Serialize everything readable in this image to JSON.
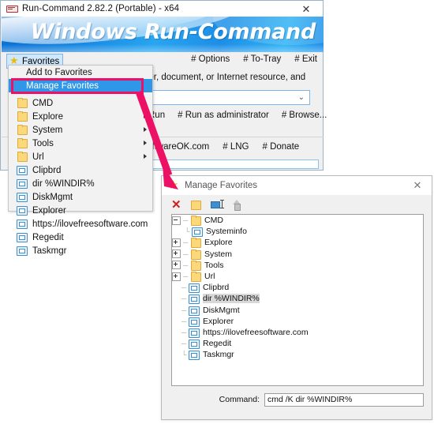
{
  "main_window": {
    "title": "Run-Command 2.82.2 (Portable) - x64",
    "close_label": "✕",
    "banner_text": "Windows Run-Command",
    "favorites_button": "Favorites",
    "top_menu": [
      "# Options",
      "# To-Tray",
      "# Exit"
    ],
    "description": "der, document, or Internet resource, and",
    "combo_value": "",
    "combo_chevron": "⌄",
    "action_buttons": [
      "Run",
      "# Run as administrator",
      "# Browse..."
    ],
    "footer_items": [
      "oftwareOK.com",
      "# LNG",
      "# Donate"
    ]
  },
  "favorites_menu": {
    "top_items": [
      {
        "label": "Add to Favorites",
        "selected": false
      },
      {
        "label": "Manage Favorites",
        "selected": true
      }
    ],
    "folders": [
      {
        "label": "CMD",
        "icon": "folder-icon",
        "has_submenu": true
      },
      {
        "label": "Explore",
        "icon": "folder-icon",
        "has_submenu": true
      },
      {
        "label": "System",
        "icon": "folder-icon",
        "has_submenu": true
      },
      {
        "label": "Tools",
        "icon": "folder-icon",
        "has_submenu": true
      },
      {
        "label": "Url",
        "icon": "folder-icon",
        "has_submenu": true
      }
    ],
    "commands": [
      {
        "label": "Clipbrd",
        "icon": "script-icon"
      },
      {
        "label": "dir %WINDIR%",
        "icon": "script-icon"
      },
      {
        "label": "DiskMgmt",
        "icon": "script-icon"
      },
      {
        "label": "Explorer",
        "icon": "script-icon"
      },
      {
        "label": "https://ilovefreesoftware.com",
        "icon": "script-icon"
      },
      {
        "label": "Regedit",
        "icon": "script-icon"
      },
      {
        "label": "Taskmgr",
        "icon": "script-icon"
      }
    ]
  },
  "manage_favorites": {
    "title": "Manage Favorites",
    "close_label": "✕",
    "toolbar": [
      {
        "name": "delete-icon",
        "glyph": "✕"
      },
      {
        "name": "new-folder-icon",
        "glyph": ""
      },
      {
        "name": "rename-icon",
        "glyph": ""
      },
      {
        "name": "move-up-icon",
        "glyph": ""
      }
    ],
    "tree": [
      {
        "label": "CMD",
        "icon": "folder-icon",
        "expander": "minus",
        "indent": 0,
        "selected": false
      },
      {
        "label": "Systeminfo",
        "icon": "script-icon",
        "expander": "none",
        "indent": 1,
        "selected": false
      },
      {
        "label": "Explore",
        "icon": "folder-icon",
        "expander": "plus",
        "indent": 0,
        "selected": false
      },
      {
        "label": "System",
        "icon": "folder-icon",
        "expander": "plus",
        "indent": 0,
        "selected": false
      },
      {
        "label": "Tools",
        "icon": "folder-icon",
        "expander": "plus",
        "indent": 0,
        "selected": false
      },
      {
        "label": "Url",
        "icon": "folder-icon",
        "expander": "plus",
        "indent": 0,
        "selected": false
      },
      {
        "label": "Clipbrd",
        "icon": "script-icon",
        "expander": "none",
        "indent": 0,
        "selected": false
      },
      {
        "label": "dir %WINDIR%",
        "icon": "script-icon",
        "expander": "none",
        "indent": 0,
        "selected": true
      },
      {
        "label": "DiskMgmt",
        "icon": "script-icon",
        "expander": "none",
        "indent": 0,
        "selected": false
      },
      {
        "label": "Explorer",
        "icon": "script-icon",
        "expander": "none",
        "indent": 0,
        "selected": false
      },
      {
        "label": "https://ilovefreesoftware.com",
        "icon": "script-icon",
        "expander": "none",
        "indent": 0,
        "selected": false
      },
      {
        "label": "Regedit",
        "icon": "script-icon",
        "expander": "none",
        "indent": 0,
        "selected": false
      },
      {
        "label": "Taskmgr",
        "icon": "script-icon",
        "expander": "none",
        "indent": 0,
        "selected": false
      }
    ],
    "command_label": "Command:",
    "command_value": "cmd /K dir %WINDIR%"
  },
  "annotation": {
    "highlight_color": "#ec1164",
    "arrow_color": "#ec1164"
  }
}
